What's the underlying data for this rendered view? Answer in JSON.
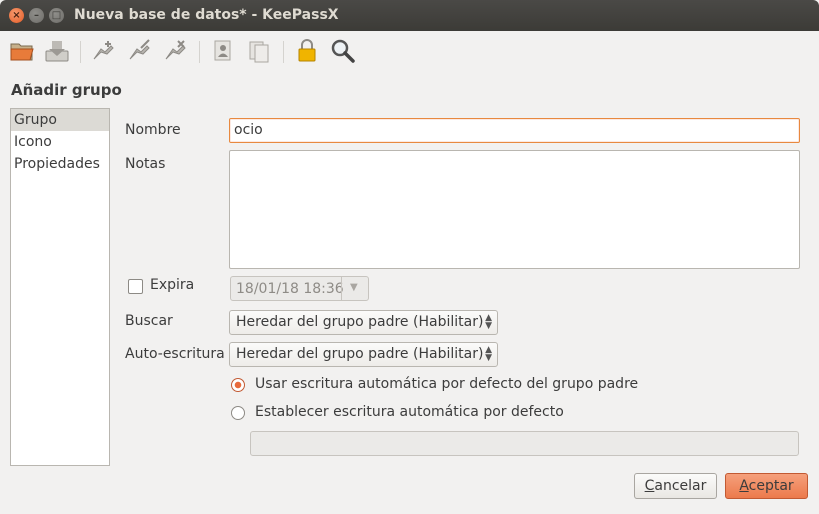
{
  "window": {
    "title": "Nueva base de datos* - KeePassX",
    "close_glyph": "×",
    "minimize_glyph": "–",
    "maximize_glyph": "□"
  },
  "toolbar": {
    "items": [
      {
        "icon": "open-database-icon"
      },
      {
        "icon": "save-database-icon"
      },
      {
        "icon": "add-entry-icon"
      },
      {
        "icon": "edit-entry-icon"
      },
      {
        "icon": "delete-entry-icon"
      },
      {
        "icon": "copy-username-icon"
      },
      {
        "icon": "copy-password-icon"
      },
      {
        "icon": "lock-database-icon"
      },
      {
        "icon": "search-icon"
      }
    ]
  },
  "dialog": {
    "heading": "Añadir grupo",
    "sidebar": {
      "items": [
        {
          "label": "Grupo",
          "selected": true
        },
        {
          "label": "Icono",
          "selected": false
        },
        {
          "label": "Propiedades",
          "selected": false
        }
      ]
    },
    "form": {
      "name_label": "Nombre",
      "name_value": "ocio",
      "notes_label": "Notas",
      "notes_value": "",
      "expires_label": "Expira",
      "expires_checked": false,
      "expires_date": "18/01/18 18:36",
      "search_label": "Buscar",
      "search_value": "Heredar del grupo padre (Habilitar)",
      "autotype_label": "Auto-escritura",
      "autotype_value": "Heredar del grupo padre (Habilitar)",
      "radio_inherit_label": "Usar escritura automática por defecto del grupo padre",
      "radio_inherit_checked": true,
      "radio_custom_label": "Establecer escritura automática por defecto",
      "radio_custom_checked": false,
      "custom_sequence_value": ""
    },
    "buttons": {
      "cancel": "Cancelar",
      "accept": "Aceptar"
    }
  },
  "colors": {
    "accent": "#e86a3b",
    "titlebar": "#3c3b37",
    "background": "#f2f1f0"
  }
}
